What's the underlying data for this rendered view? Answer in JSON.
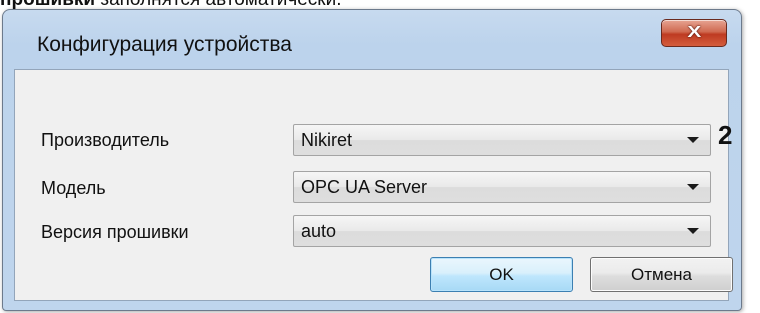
{
  "doc_text": {
    "bold": "прошивки",
    "rest": " заполнятся автоматически."
  },
  "dialog": {
    "title": "Конфигурация устройства",
    "close_label": "X"
  },
  "form": {
    "manufacturer": {
      "label": "Производитель",
      "value": "Nikiret"
    },
    "model": {
      "label": "Модель",
      "value": "OPC UA Server"
    },
    "firmware": {
      "label": "Версия прошивки",
      "value": "auto"
    },
    "callout_marker": "2"
  },
  "buttons": {
    "ok": "OK",
    "cancel": "Отмена"
  },
  "icons": {
    "close": "close-icon",
    "dropdown": "chevron-down-icon"
  }
}
